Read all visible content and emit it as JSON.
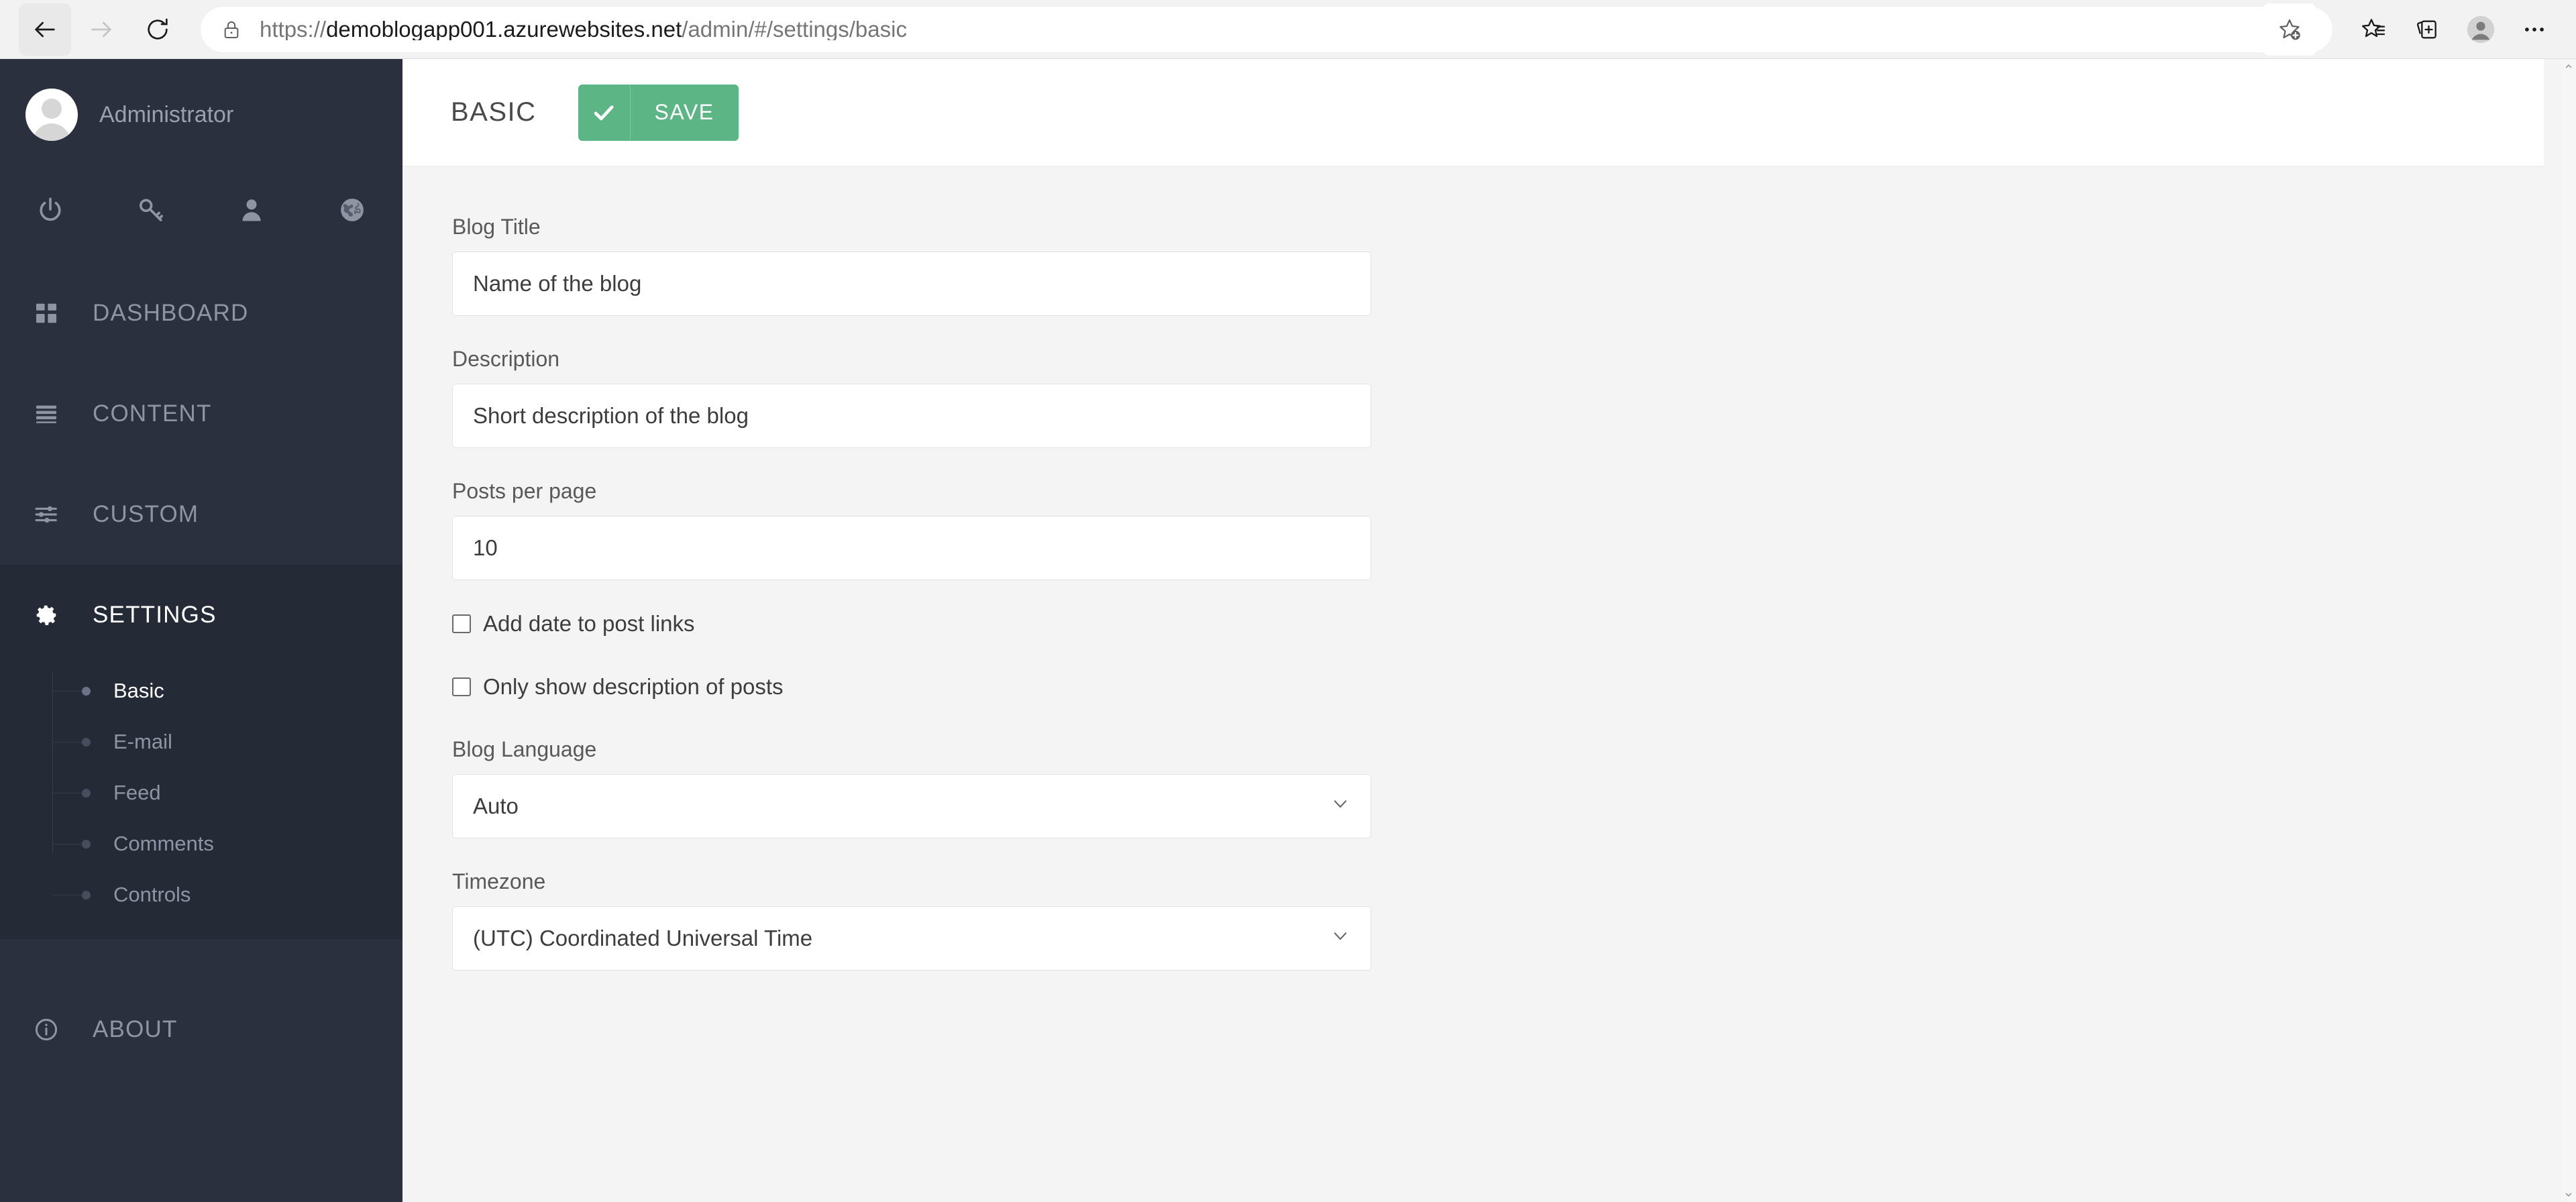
{
  "browser": {
    "back_label": "Back",
    "forward_label": "Forward",
    "reload_label": "Refresh",
    "url_scheme": "https://",
    "url_host": "demoblogapp001.azurewebsites.net",
    "url_path": "/admin/#/settings/basic",
    "url_full": "https://demoblogapp001.azurewebsites.net/admin/#/settings/basic",
    "favorite_add_label": "Add this page to favorites",
    "favorites_label": "Favorites",
    "collections_label": "Collections",
    "profile_label": "Profile",
    "more_label": "Settings and more"
  },
  "sidebar": {
    "user_name": "Administrator",
    "quick_icons": [
      {
        "name": "power-icon",
        "label": "Log out"
      },
      {
        "name": "key-icon",
        "label": "Change password"
      },
      {
        "name": "user-icon",
        "label": "Profile"
      },
      {
        "name": "globe-icon",
        "label": "View site"
      }
    ],
    "nav_items": [
      {
        "label": "DASHBOARD",
        "icon": "grid-icon",
        "active": false
      },
      {
        "label": "CONTENT",
        "icon": "list-icon",
        "active": false
      },
      {
        "label": "CUSTOM",
        "icon": "sliders-icon",
        "active": false
      },
      {
        "label": "SETTINGS",
        "icon": "gear-icon",
        "active": true
      }
    ],
    "submenu": [
      {
        "label": "Basic",
        "active": true
      },
      {
        "label": "E-mail",
        "active": false
      },
      {
        "label": "Feed",
        "active": false
      },
      {
        "label": "Comments",
        "active": false
      },
      {
        "label": "Controls",
        "active": false
      }
    ],
    "about": {
      "label": "ABOUT",
      "icon": "info-icon"
    }
  },
  "content": {
    "title": "BASIC",
    "save_label": "SAVE",
    "fields": {
      "blog_title": {
        "label": "Blog Title",
        "value": "Name of the blog",
        "placeholder": "Name of the blog"
      },
      "description": {
        "label": "Description",
        "value": "Short description of the blog",
        "placeholder": "Short description of the blog"
      },
      "posts_per_page": {
        "label": "Posts per page",
        "value": "10",
        "placeholder": "10"
      },
      "add_date": {
        "label": "Add date to post links",
        "checked": false
      },
      "only_description": {
        "label": "Only show description of posts",
        "checked": false
      },
      "blog_language": {
        "label": "Blog Language",
        "value": "Auto"
      },
      "timezone": {
        "label": "Timezone",
        "value": "(UTC) Coordinated Universal Time"
      }
    }
  },
  "colors": {
    "sidebar_bg": "#2b303f",
    "sidebar_active_bg": "#252a37",
    "accent_green": "#5cb585",
    "content_bg": "#f4f4f4"
  }
}
